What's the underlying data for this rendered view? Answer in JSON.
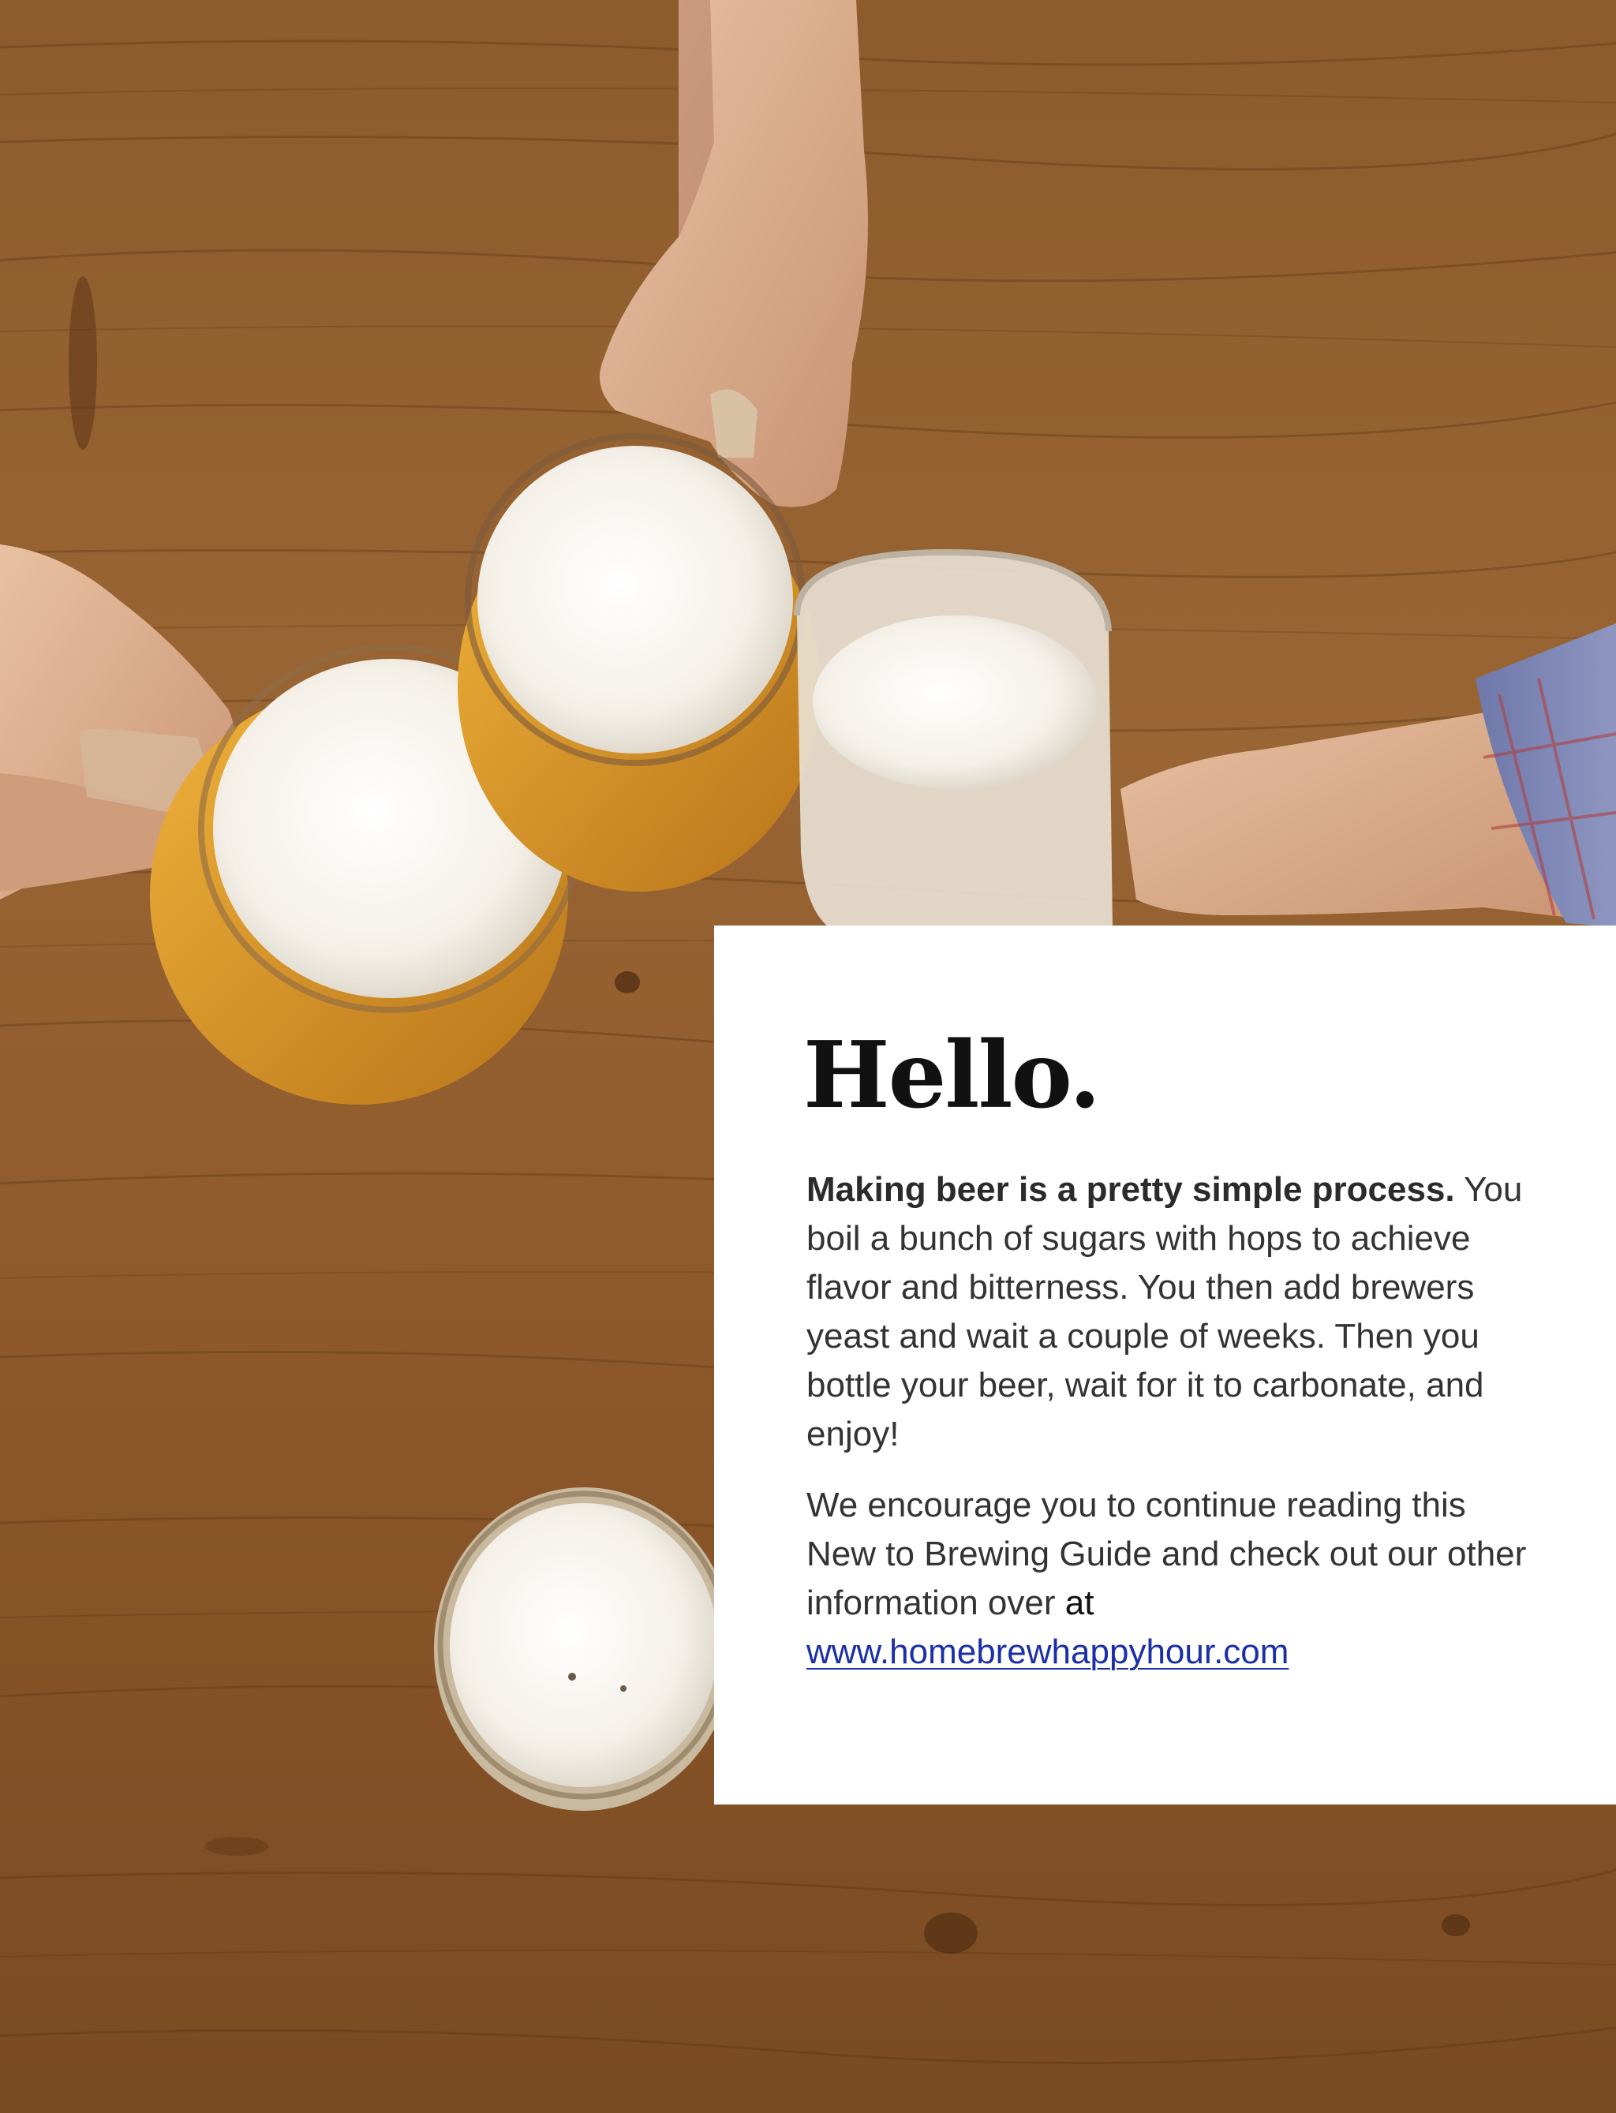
{
  "photo": {
    "description_icon": "beer-mugs-toast-photo",
    "colors": {
      "wood_light": "#a66f3a",
      "wood_dark": "#6b4020",
      "foam": "#f6f2ea",
      "beer": "#d89426",
      "skin": "#e2b694",
      "shirt": "#7d86b3"
    }
  },
  "card": {
    "headline": "Hello.",
    "paragraph1": {
      "lead": "Making beer is a pretty simple process.",
      "body": "You boil a bunch of sugars with hops to achieve flavor and bitterness. You then add brewers yeast and wait a couple of weeks. Then you bottle your beer, wait for it to carbonate, and enjoy!"
    },
    "paragraph2": {
      "body": "We encourage you to continue reading this New to Brewing Guide and check out our other information over",
      "at": "at",
      "link": "www.homebrewhappyhour.com"
    }
  }
}
